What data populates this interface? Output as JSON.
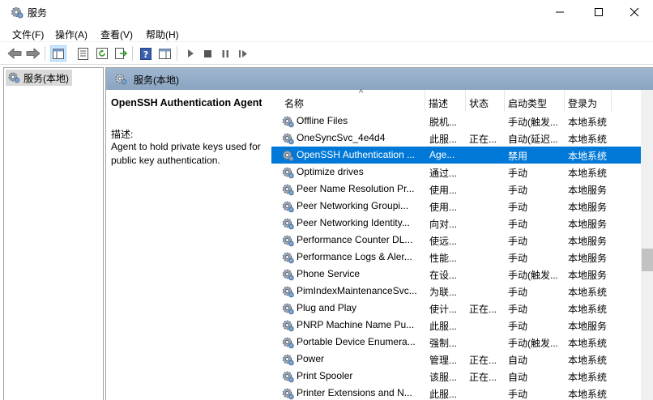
{
  "window": {
    "title": "服务"
  },
  "menu": {
    "items": [
      "文件(F)",
      "操作(A)",
      "查看(V)",
      "帮助(H)"
    ]
  },
  "tree": {
    "root_label": "服务(本地)"
  },
  "pane": {
    "header_label": "服务(本地)"
  },
  "detail": {
    "service_name": "OpenSSH Authentication Agent",
    "desc_label": "描述:",
    "description": "Agent to hold private keys used for public key authentication."
  },
  "columns": {
    "name": "名称",
    "desc": "描述",
    "state": "状态",
    "startup": "启动类型",
    "logon": "登录为"
  },
  "services": [
    {
      "name": "Offline Files",
      "desc": "脱机...",
      "state": "",
      "startup": "手动(触发...",
      "logon": "本地系统"
    },
    {
      "name": "OneSyncSvc_4e4d4",
      "desc": "此服...",
      "state": "正在...",
      "startup": "自动(延迟...",
      "logon": "本地系统"
    },
    {
      "name": "OpenSSH Authentication ...",
      "desc": "Age...",
      "state": "",
      "startup": "禁用",
      "logon": "本地系统",
      "selected": true
    },
    {
      "name": "Optimize drives",
      "desc": "通过...",
      "state": "",
      "startup": "手动",
      "logon": "本地系统"
    },
    {
      "name": "Peer Name Resolution Pr...",
      "desc": "使用...",
      "state": "",
      "startup": "手动",
      "logon": "本地服务"
    },
    {
      "name": "Peer Networking Groupi...",
      "desc": "使用...",
      "state": "",
      "startup": "手动",
      "logon": "本地服务"
    },
    {
      "name": "Peer Networking Identity...",
      "desc": "向对...",
      "state": "",
      "startup": "手动",
      "logon": "本地服务"
    },
    {
      "name": "Performance Counter DL...",
      "desc": "使远...",
      "state": "",
      "startup": "手动",
      "logon": "本地服务"
    },
    {
      "name": "Performance Logs & Aler...",
      "desc": "性能...",
      "state": "",
      "startup": "手动",
      "logon": "本地服务"
    },
    {
      "name": "Phone Service",
      "desc": "在设...",
      "state": "",
      "startup": "手动(触发...",
      "logon": "本地服务"
    },
    {
      "name": "PimIndexMaintenanceSvc...",
      "desc": "为联...",
      "state": "",
      "startup": "手动",
      "logon": "本地系统"
    },
    {
      "name": "Plug and Play",
      "desc": "使计...",
      "state": "正在...",
      "startup": "手动",
      "logon": "本地系统"
    },
    {
      "name": "PNRP Machine Name Pu...",
      "desc": "此服...",
      "state": "",
      "startup": "手动",
      "logon": "本地服务"
    },
    {
      "name": "Portable Device Enumera...",
      "desc": "强制...",
      "state": "",
      "startup": "手动(触发...",
      "logon": "本地系统"
    },
    {
      "name": "Power",
      "desc": "管理...",
      "state": "正在...",
      "startup": "自动",
      "logon": "本地系统"
    },
    {
      "name": "Print Spooler",
      "desc": "该服...",
      "state": "正在...",
      "startup": "自动",
      "logon": "本地系统"
    },
    {
      "name": "Printer Extensions and N...",
      "desc": "此服...",
      "state": "",
      "startup": "手动",
      "logon": "本地系统"
    }
  ],
  "icons": {
    "app": "services-gear-icon",
    "toolbar": [
      "back-arrow-icon",
      "forward-arrow-icon",
      "show-hide-tree-icon",
      "properties-icon",
      "refresh-icon",
      "export-list-icon",
      "help-icon",
      "action-pane-icon",
      "start-service-icon",
      "stop-service-icon",
      "pause-service-icon",
      "restart-service-icon"
    ],
    "service": "service-gear-icon"
  },
  "colors": {
    "selection": "#0078d7",
    "pane_header": "#9fb6cf"
  }
}
